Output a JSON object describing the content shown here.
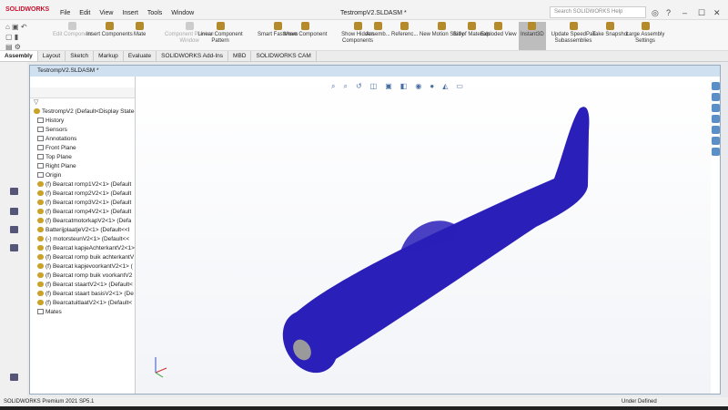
{
  "app": {
    "logo": "SOLIDWORKS",
    "title": "TestrompV2.SLDASM *",
    "search_placeholder": "Search SOLIDWORKS Help"
  },
  "menu": [
    "File",
    "Edit",
    "View",
    "Insert",
    "Tools",
    "Window"
  ],
  "ribbon": [
    {
      "label": "Edit Component",
      "disabled": true
    },
    {
      "label": "Insert Components"
    },
    {
      "label": "Mate"
    },
    {
      "label": "Component Preview Window",
      "disabled": true
    },
    {
      "label": "Linear Component Pattern"
    },
    {
      "label": "Smart Fasteners"
    },
    {
      "label": "Move Component"
    },
    {
      "label": "Show Hidden Components"
    },
    {
      "label": "Assemb..."
    },
    {
      "label": "Referenc..."
    },
    {
      "label": "New Motion Study"
    },
    {
      "label": "Bill of Materials"
    },
    {
      "label": "Exploded View"
    },
    {
      "label": "Instant3D",
      "active": true
    },
    {
      "label": "Update SpeedPak Subassemblies"
    },
    {
      "label": "Take Snapshot"
    },
    {
      "label": "Large Assembly Settings"
    }
  ],
  "tabs": [
    "Assembly",
    "Layout",
    "Sketch",
    "Markup",
    "Evaluate",
    "SOLIDWORKS Add-Ins",
    "MBD",
    "SOLIDWORKS CAM"
  ],
  "document": {
    "title": "TestrompV2.SLDASM *"
  },
  "tree": [
    {
      "label": "TestrompV2  (Default<Display State-",
      "type": "asm",
      "level": 0
    },
    {
      "label": "History",
      "type": "folder",
      "level": 1
    },
    {
      "label": "Sensors",
      "type": "folder",
      "level": 1
    },
    {
      "label": "Annotations",
      "type": "folder",
      "level": 1
    },
    {
      "label": "Front Plane",
      "type": "folder",
      "level": 1
    },
    {
      "label": "Top Plane",
      "type": "folder",
      "level": 1
    },
    {
      "label": "Right Plane",
      "type": "folder",
      "level": 1
    },
    {
      "label": "Origin",
      "type": "folder",
      "level": 1
    },
    {
      "label": "(f) Bearcat romp1V2<1> (Default",
      "type": "part",
      "level": 1
    },
    {
      "label": "(f) Bearcat romp2V2<1> (Default",
      "type": "part",
      "level": 1
    },
    {
      "label": "(f) Bearcat romp3V2<1> (Default",
      "type": "part",
      "level": 1
    },
    {
      "label": "(f) Bearcat romp4V2<1> (Default",
      "type": "part",
      "level": 1
    },
    {
      "label": "(f) BearcatmotorkapV2<1> (Defa",
      "type": "part",
      "level": 1
    },
    {
      "label": "BatterijplaatjeV2<1> (Default<<I",
      "type": "part",
      "level": 1
    },
    {
      "label": "(-) motorsteunV2<1> (Default<<",
      "type": "part",
      "level": 1
    },
    {
      "label": "(f) Bearcat kapjeAchterkantV2<1>",
      "type": "part",
      "level": 1
    },
    {
      "label": "(f) Bearcat romp buik achterkantV",
      "type": "part",
      "level": 1
    },
    {
      "label": "(f) Bearcat kapjevoorkantV2<1> (",
      "type": "part",
      "level": 1
    },
    {
      "label": "(f) Bearcat romp buik voorkantV2",
      "type": "part",
      "level": 1
    },
    {
      "label": "(f) Bearcat staartV2<1> (Default<",
      "type": "part",
      "level": 1
    },
    {
      "label": "(f) Bearcat staart basisV2<1> (De",
      "type": "part",
      "level": 1
    },
    {
      "label": "(f) BearcatuitlaatV2<1> (Default<",
      "type": "part",
      "level": 1
    },
    {
      "label": "Mates",
      "type": "folder",
      "level": 1
    }
  ],
  "status": {
    "left": "SOLIDWORKS Premium 2021 SP5.1",
    "right": "Under Defined"
  },
  "colors": {
    "model": "#2a1fb8",
    "accent": "#c8102e"
  }
}
